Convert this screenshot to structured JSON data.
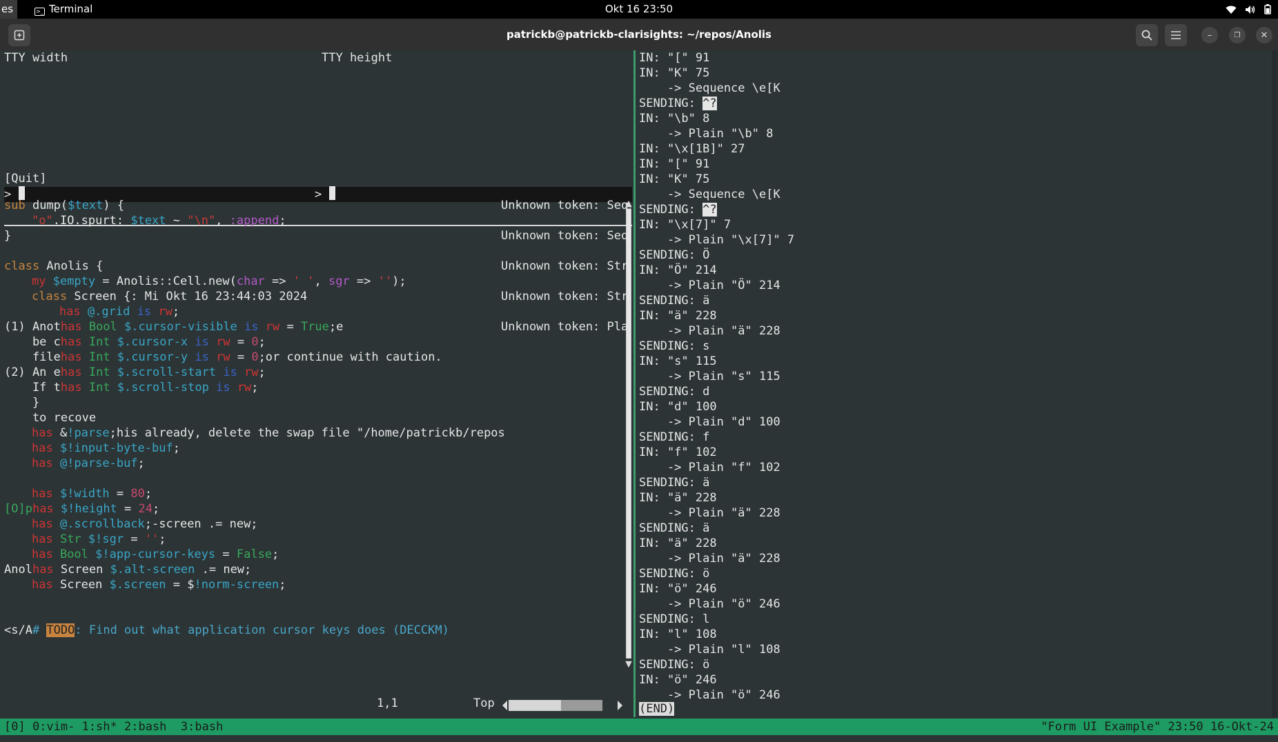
{
  "topbar": {
    "activities": "es",
    "app_name": "Terminal",
    "clock": "Okt 16  23:50"
  },
  "window": {
    "title": "patrickb@patrickb-clarisights: ~/repos/Anolis"
  },
  "tui": {
    "label_width": "TTY width",
    "label_height": "TTY height",
    "prompt_left": ">",
    "prompt_right": ">",
    "quit": "[Quit]"
  },
  "vim": {
    "l0_kw": "sub",
    "l0_a": " dump(",
    "l0_var": "$text",
    "l0_b": ") {",
    "l1_str": "\"o\"",
    "l1_a": ".IO.spurt: ",
    "l1_var": "$text",
    "l1_b": " ~ ",
    "l1_str2": "\"\\n\"",
    "l1_c": ", ",
    "l1_pur": ":append",
    "l1_d": ";",
    "l2": "}",
    "l4_kw": "class",
    "l4_a": " Anolis {",
    "l5_red": "my",
    "l5_var": " $empty",
    "l5_a": " = Anolis::Cell.new(",
    "l5_pur": "char",
    "l5_b": " => ",
    "l5_str": "' '",
    "l5_c": ", ",
    "l5_pur2": "sgr",
    "l5_d": " => ",
    "l5_str2": "''",
    "l5_e": ");",
    "l6_kw": "class",
    "l6_a": " Screen {: Mi Okt 16 23:44:03 2024",
    "l7_red": "has",
    "l7_var": " @.grid",
    "l7_blue": " is",
    "l7_red2": " rw",
    "l7_a": ";",
    "l8_a": "(1) Anot",
    "l8_red": "has",
    "l8_grn": " Bool",
    "l8_var": " $.cursor-visible",
    "l8_blue": " is",
    "l8_red2": " rw",
    "l8_b": " = ",
    "l8_grn2": "True",
    "l8_c": ";e",
    "l9_a": "    be c",
    "l9_red": "has",
    "l9_grn": " Int",
    "l9_var": " $.cursor-x",
    "l9_blue": " is",
    "l9_red2": " rw",
    "l9_b": " = ",
    "l9_pink": "0",
    "l9_c": ";",
    "l10_a": "    file",
    "l10_red": "has",
    "l10_grn": " Int",
    "l10_var": " $.cursor-y",
    "l10_blue": " is",
    "l10_red2": " rw",
    "l10_b": " = ",
    "l10_pink": "0",
    "l10_c": ";or continue with caution.",
    "l11_a": "(2) An e",
    "l11_red": "has",
    "l11_grn": " Int",
    "l11_var": " $.scroll-start",
    "l11_blue": " is",
    "l11_red2": " rw",
    "l11_c": ";",
    "l12_a": "    If t",
    "l12_red": "has",
    "l12_grn": " Int",
    "l12_var": " $.scroll-stop",
    "l12_blue": " is",
    "l12_red2": " rw",
    "l12_c": ";",
    "l13": "    }",
    "l14": "    to recove",
    "l15_red": "has",
    "l15_a": " &",
    "l15_var": "!parse",
    "l15_b": ";his already, delete the swap file \"/home/patrickb/repos",
    "l16_red": "has",
    "l16_var": " $!input-byte-buf",
    "l16_a": ";",
    "l17_red": "has",
    "l17_var": " @!parse-buf",
    "l17_a": ";",
    "l19_red": "has",
    "l19_var": " $!width",
    "l19_a": " = ",
    "l19_pink": "80",
    "l19_b": ";",
    "l20_a": "[O]p",
    "l20_red": "has",
    "l20_var": " $!height",
    "l20_b": " = ",
    "l20_pink": "24",
    "l20_c": ";",
    "l21_red": "has",
    "l21_var": " @.scrollback",
    "l21_a": ";-screen .= new;",
    "l22_red": "has",
    "l22_grn": " Str",
    "l22_var": " $!sgr",
    "l22_a": " = ",
    "l22_str": "''",
    "l22_b": ";",
    "l23_red": "has",
    "l23_grn": " Bool",
    "l23_var": " $!app-cursor-keys",
    "l23_a": " = ",
    "l23_grn2": "False",
    "l23_b": ";",
    "l24_a": "Anol",
    "l24_red": "has",
    "l24_a2": " Screen ",
    "l24_var": "$.alt-screen",
    "l24_b": " .= new;",
    "l25_red": "has",
    "l25_a": " Screen ",
    "l25_var": "$.screen",
    "l25_b": " = $",
    "l25_var2": "!norm-screen",
    "l25_c": ";",
    "l28_a": "<s/A",
    "l28_cmt1": "# ",
    "l28_todo": "TODO",
    "l28_cmt2": ": Find out what application cursor keys does (DECCKM)",
    "ruler_pos": "1,1",
    "ruler_top": "Top"
  },
  "unknown_tokens": [
    "Unknown token: Seq",
    "Unknown token: Seq",
    "Unknown token: Str",
    "Unknown token: Str",
    "Unknown token: Pla"
  ],
  "log": [
    "IN: \"[\" 91",
    "IN: \"K\" 75",
    "    -> Sequence \\e[K",
    "SENDING: ",
    "IN: \"\\b\" 8",
    "    -> Plain \"\\b\" 8",
    "IN: \"\\x[1B]\" 27",
    "IN: \"[\" 91",
    "IN: \"K\" 75",
    "    -> Sequence \\e[K",
    "SENDING: ",
    "IN: \"\\x[7]\" 7",
    "    -> Plain \"\\x[7]\" 7",
    "SENDING: Ö",
    "IN: \"Ö\" 214",
    "    -> Plain \"Ö\" 214",
    "SENDING: ä",
    "IN: \"ä\" 228",
    "    -> Plain \"ä\" 228",
    "SENDING: s",
    "IN: \"s\" 115",
    "    -> Plain \"s\" 115",
    "SENDING: d",
    "IN: \"d\" 100",
    "    -> Plain \"d\" 100",
    "SENDING: f",
    "IN: \"f\" 102",
    "    -> Plain \"f\" 102",
    "SENDING: ä",
    "IN: \"ä\" 228",
    "    -> Plain \"ä\" 228",
    "SENDING: ä",
    "IN: \"ä\" 228",
    "    -> Plain \"ä\" 228",
    "SENDING: ö",
    "IN: \"ö\" 246",
    "    -> Plain \"ö\" 246",
    "SENDING: l",
    "IN: \"l\" 108",
    "    -> Plain \"l\" 108",
    "SENDING: ö",
    "IN: \"ö\" 246",
    "    -> Plain \"ö\" 246"
  ],
  "log_caret": "^?",
  "pager_end": "(END)",
  "tmux": {
    "windows": "[0] 0:vim- 1:sh* 2:bash  3:bash",
    "right": "\"Form UI Example\" 23:50 16-Okt-24"
  },
  "colors": {
    "tmux_green": "#1e9b62",
    "term_bg": "#2c3436",
    "keyword": "#c7843f",
    "variable": "#3aa6c6"
  },
  "icons": [
    "terminal-icon",
    "new-tab-icon",
    "search-icon",
    "hamburger-menu-icon",
    "minimize-icon",
    "restore-icon",
    "close-icon",
    "wifi-icon",
    "volume-icon",
    "battery-icon"
  ]
}
